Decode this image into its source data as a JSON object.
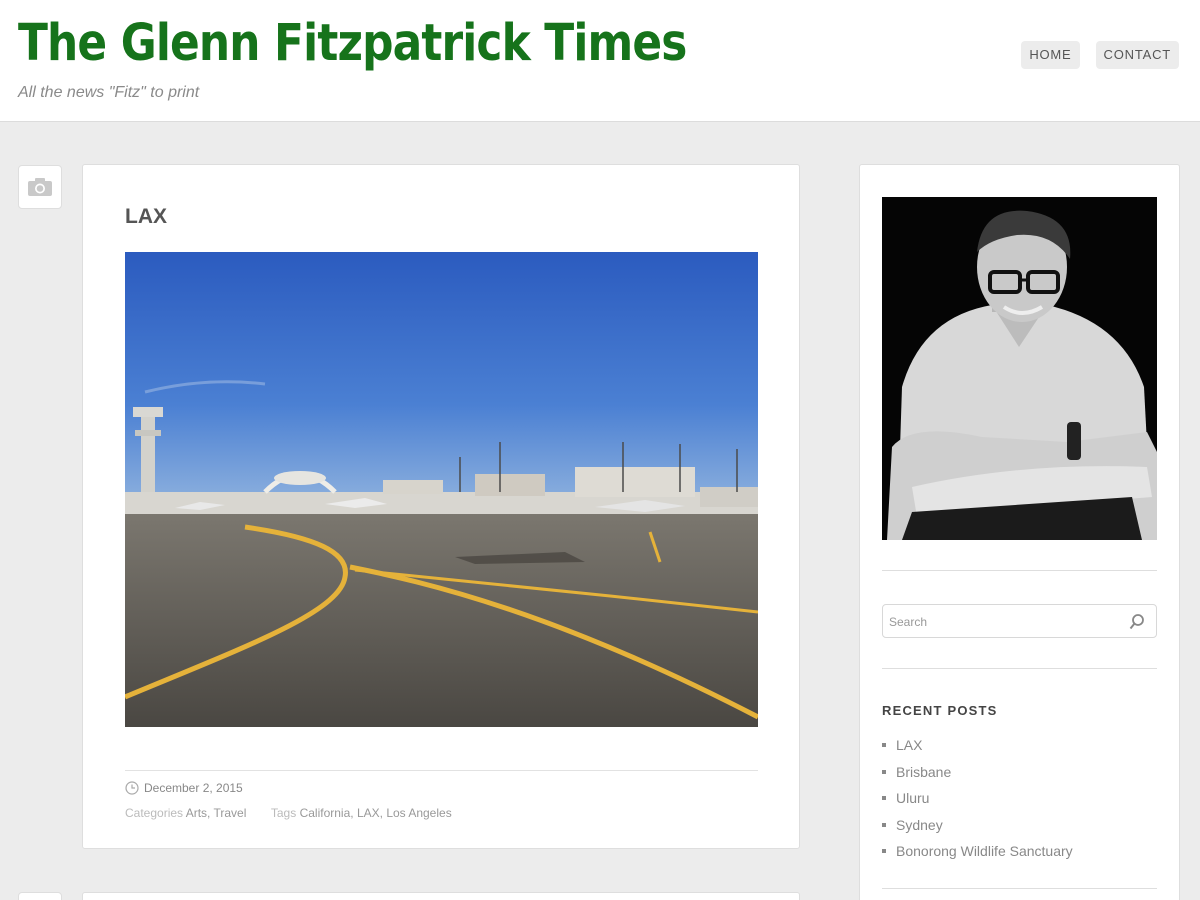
{
  "site": {
    "title": "The Glenn Fitzpatrick Times",
    "tagline": "All the news \"Fitz\" to print",
    "title_color": "#16731b"
  },
  "nav": {
    "items": [
      {
        "label": "HOME"
      },
      {
        "label": "CONTACT"
      }
    ]
  },
  "post": {
    "format_icon": "camera-icon",
    "title": "LAX",
    "image_subject": "lax-airport-tarmac-photo",
    "date": "December 2, 2015",
    "categories_label": "Categories",
    "categories": [
      "Arts",
      "Travel"
    ],
    "tags_label": "Tags",
    "tags": [
      "California",
      "LAX",
      "Los Angeles"
    ]
  },
  "sidebar": {
    "portrait_subject": "author-portrait",
    "search": {
      "placeholder": "Search",
      "value": ""
    },
    "recent_posts": {
      "title": "RECENT POSTS",
      "items": [
        "LAX",
        "Brisbane",
        "Uluru",
        "Sydney",
        "Bonorong Wildlife Sanctuary"
      ]
    }
  }
}
